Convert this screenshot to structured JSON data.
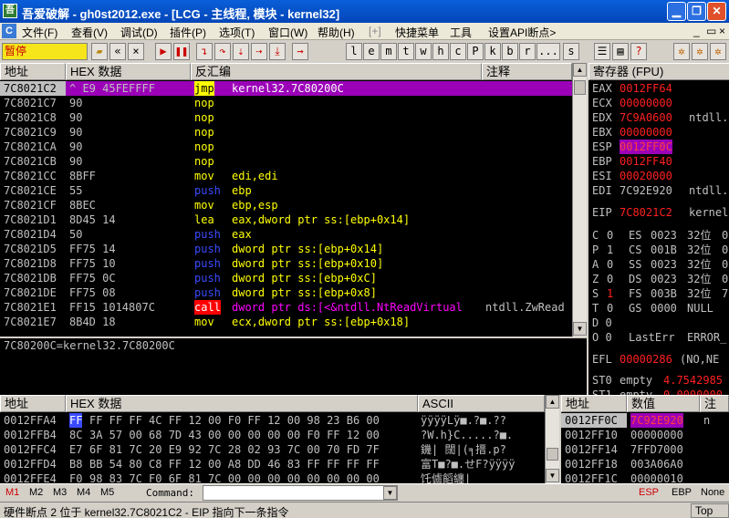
{
  "title_bar": {
    "title": "吾爱破解 - gh0st2012.exe - [LCG - 主线程, 模块 - kernel32]",
    "icon": "app-icon",
    "minimize_icon": "minimize-icon",
    "restore_icon": "restore-icon",
    "close_icon": "close-icon"
  },
  "menu": {
    "items": [
      "文件(F)",
      "查看(V)",
      "调试(D)",
      "插件(P)",
      "选项(T)",
      "窗口(W)",
      "帮助(H)",
      "[+]",
      "快捷菜单",
      "工具",
      "设置API断点>"
    ],
    "mdi_minimize": "_",
    "mdi_restore": "▭",
    "mdi_close": "×"
  },
  "toolbar": {
    "status": "暂停",
    "letters": [
      "l",
      "e",
      "m",
      "t",
      "w",
      "h",
      "c",
      "P",
      "k",
      "b",
      "r",
      "...",
      "s"
    ],
    "icons": [
      "open-icon",
      "restart-icon",
      "close-icon",
      "run-icon",
      "pause-icon",
      "step-into-icon",
      "step-over-icon",
      "trace-into-icon",
      "trace-over-icon",
      "execute-till-return-icon",
      "goto-icon"
    ]
  },
  "disasm": {
    "headers": [
      "地址",
      "HEX 数据",
      "反汇编",
      "注释"
    ],
    "rows": [
      {
        "addr": "7C8021C2",
        "hex": "^ E9 45FEFFFF",
        "mn": "jmp",
        "op": "kernel32.7C80200C",
        "comment": "",
        "mncolor": "#ffff00",
        "opcolor": "#ffffff",
        "selected": true
      },
      {
        "addr": "7C8021C7",
        "hex": "90",
        "mn": "nop",
        "op": "",
        "comment": "",
        "mncolor": "#ffff00",
        "opcolor": "#ffff00"
      },
      {
        "addr": "7C8021C8",
        "hex": "90",
        "mn": "nop",
        "op": "",
        "comment": "",
        "mncolor": "#ffff00",
        "opcolor": "#ffff00"
      },
      {
        "addr": "7C8021C9",
        "hex": "90",
        "mn": "nop",
        "op": "",
        "comment": "",
        "mncolor": "#ffff00",
        "opcolor": "#ffff00"
      },
      {
        "addr": "7C8021CA",
        "hex": "90",
        "mn": "nop",
        "op": "",
        "comment": "",
        "mncolor": "#ffff00",
        "opcolor": "#ffff00"
      },
      {
        "addr": "7C8021CB",
        "hex": "90",
        "mn": "nop",
        "op": "",
        "comment": "",
        "mncolor": "#ffff00",
        "opcolor": "#ffff00"
      },
      {
        "addr": "7C8021CC",
        "hex": "8BFF",
        "mn": "mov",
        "op": "edi,edi",
        "comment": "",
        "mncolor": "#ffff00",
        "opcolor": "#ffff00"
      },
      {
        "addr": "7C8021CE",
        "hex": "55",
        "mn": "push",
        "op": "ebp",
        "comment": "",
        "mncolor": "#3a4bff",
        "opcolor": "#ffff00"
      },
      {
        "addr": "7C8021CF",
        "hex": "8BEC",
        "mn": "mov",
        "op": "ebp,esp",
        "comment": "",
        "mncolor": "#ffff00",
        "opcolor": "#ffff00"
      },
      {
        "addr": "7C8021D1",
        "hex": "8D45 14",
        "mn": "lea",
        "op": "eax,dword ptr ss:[ebp+0x14]",
        "comment": "",
        "mncolor": "#ffff00",
        "opcolor": "#ffff00"
      },
      {
        "addr": "7C8021D4",
        "hex": "50",
        "mn": "push",
        "op": "eax",
        "comment": "",
        "mncolor": "#3a4bff",
        "opcolor": "#ffff00"
      },
      {
        "addr": "7C8021D5",
        "hex": "FF75 14",
        "mn": "push",
        "op": "dword ptr ss:[ebp+0x14]",
        "comment": "",
        "mncolor": "#3a4bff",
        "opcolor": "#ffff00"
      },
      {
        "addr": "7C8021D8",
        "hex": "FF75 10",
        "mn": "push",
        "op": "dword ptr ss:[ebp+0x10]",
        "comment": "",
        "mncolor": "#3a4bff",
        "opcolor": "#ffff00"
      },
      {
        "addr": "7C8021DB",
        "hex": "FF75 0C",
        "mn": "push",
        "op": "dword ptr ss:[ebp+0xC]",
        "comment": "",
        "mncolor": "#3a4bff",
        "opcolor": "#ffff00"
      },
      {
        "addr": "7C8021DE",
        "hex": "FF75 08",
        "mn": "push",
        "op": "dword ptr ss:[ebp+0x8]",
        "comment": "",
        "mncolor": "#3a4bff",
        "opcolor": "#ffff00"
      },
      {
        "addr": "7C8021E1",
        "hex": "FF15 1014807C",
        "mn": "call",
        "op": "dword ptr ds:[<&ntdll.NtReadVirtual",
        "comment": "ntdll.ZwRead",
        "mncolor": "#ffffff",
        "mnbg": "#ff0000",
        "opcolor": "#ff00ff"
      },
      {
        "addr": "7C8021E7",
        "hex": "8B4D 18",
        "mn": "mov",
        "op": "ecx,dword ptr ss:[ebp+0x18]",
        "comment": "",
        "mncolor": "#ffff00",
        "opcolor": "#ffff00"
      }
    ],
    "info": "7C80200C=kernel32.7C80200C"
  },
  "registers": {
    "header": "寄存器 (FPU)",
    "gpr": [
      {
        "name": "EAX",
        "value": "0012FF64",
        "extra": "",
        "changed": true
      },
      {
        "name": "ECX",
        "value": "00000000",
        "extra": "",
        "changed": true
      },
      {
        "name": "EDX",
        "value": "7C9A0600",
        "extra": "ntdll.",
        "changed": true
      },
      {
        "name": "EBX",
        "value": "00000000",
        "extra": "",
        "changed": true
      },
      {
        "name": "ESP",
        "value": "0012FF0C",
        "extra": "",
        "changed": true,
        "highlight": true
      },
      {
        "name": "EBP",
        "value": "0012FF40",
        "extra": "",
        "changed": true
      },
      {
        "name": "ESI",
        "value": "00020000",
        "extra": "",
        "changed": true
      },
      {
        "name": "EDI",
        "value": "7C92E920",
        "extra": "ntdll.",
        "changed": false
      }
    ],
    "eip": {
      "name": "EIP",
      "value": "7C8021C2",
      "extra": "kernel",
      "changed": true
    },
    "flags": [
      {
        "f": "C",
        "v": "0",
        "seg": "ES",
        "sel": "0023",
        "bits": "32位",
        "extra": "0",
        "changed": false
      },
      {
        "f": "P",
        "v": "1",
        "seg": "CS",
        "sel": "001B",
        "bits": "32位",
        "extra": "0",
        "changed": false
      },
      {
        "f": "A",
        "v": "0",
        "seg": "SS",
        "sel": "0023",
        "bits": "32位",
        "extra": "0",
        "changed": false
      },
      {
        "f": "Z",
        "v": "0",
        "seg": "DS",
        "sel": "0023",
        "bits": "32位",
        "extra": "0",
        "changed": false
      },
      {
        "f": "S",
        "v": "1",
        "seg": "FS",
        "sel": "003B",
        "bits": "32位",
        "extra": "7",
        "changed": true
      },
      {
        "f": "T",
        "v": "0",
        "seg": "GS",
        "sel": "0000",
        "bits": "NULL",
        "extra": "",
        "changed": false
      }
    ],
    "d": "D  0",
    "o": "O  0",
    "lasterr_label": "LastErr",
    "lasterr_value": "ERROR_",
    "efl_label": "EFL",
    "efl_value": "00000286",
    "efl_extra": "(NO,NE",
    "st0_label": "ST0",
    "st0_value": "empty",
    "st0_extra": "4.7542985",
    "st1_label": "ST1",
    "st1_value": "empty",
    "st1_extra": "0.0000000"
  },
  "dump": {
    "headers": [
      "地址",
      "HEX 数据",
      "ASCII"
    ],
    "rows": [
      {
        "addr": "0012FFA4",
        "first": "FF",
        "hex": "FF FF FF 4C FF 12 00 F0 FF 12 00 98 23 B6 00",
        "ascii": "ÿÿÿÿLÿ■.?■.??"
      },
      {
        "addr": "0012FFB4",
        "first": "8C",
        "hex": "3A 57 00 68 7D 43 00 00 00 00 00 F0 FF 12 00",
        "ascii": "?W.h}C.....?■."
      },
      {
        "addr": "0012FFC4",
        "first": "E7",
        "hex": "6F 81 7C 20 E9 92 7C 28 02 93 7C 00 70 FD 7F",
        "ascii": "鐖| 闊|(╕搢.p?"
      },
      {
        "addr": "0012FFD4",
        "first": "B8",
        "hex": "BB 54 80 C8 FF 12 00 A8 DD 46 83 FF FF FF FF",
        "ascii": "富T■?■.せF?ÿÿÿÿ"
      },
      {
        "addr": "0012FFE4",
        "first": "F0",
        "hex": "98 83 7C F0 6F 81 7C 00 00 00 00 00 00 00 00",
        "ascii": "饦儢饀纏|"
      }
    ]
  },
  "stack": {
    "headers": [
      "地址",
      "数值",
      "注"
    ],
    "rows": [
      {
        "addr": "0012FF0C",
        "value": "7C92E920",
        "c": "n",
        "selected": true
      },
      {
        "addr": "0012FF10",
        "value": "00000000",
        "c": "",
        "selected": false
      },
      {
        "addr": "0012FF14",
        "value": "7FFD7000",
        "c": "",
        "selected": false
      },
      {
        "addr": "0012FF18",
        "value": "003A06A0",
        "c": "",
        "selected": false
      },
      {
        "addr": "0012FF1C",
        "value": "00000010",
        "c": "",
        "selected": false
      }
    ]
  },
  "bottom": {
    "tabs": [
      "M1",
      "M2",
      "M3",
      "M4",
      "M5"
    ],
    "command_label": "Command:",
    "command_value": "",
    "reg_tabs": [
      "ESP",
      "EBP",
      "None"
    ]
  },
  "status_bar": {
    "text": "硬件断点 2 位于 kernel32.7C8021C2 - EIP 指向下一条指令",
    "right": "Top"
  },
  "colors": {
    "accent_blue": "#0a5fd8",
    "selection_purple": "#9b00b8",
    "changed_red": "#ff2020",
    "call_red": "#ff0000"
  }
}
